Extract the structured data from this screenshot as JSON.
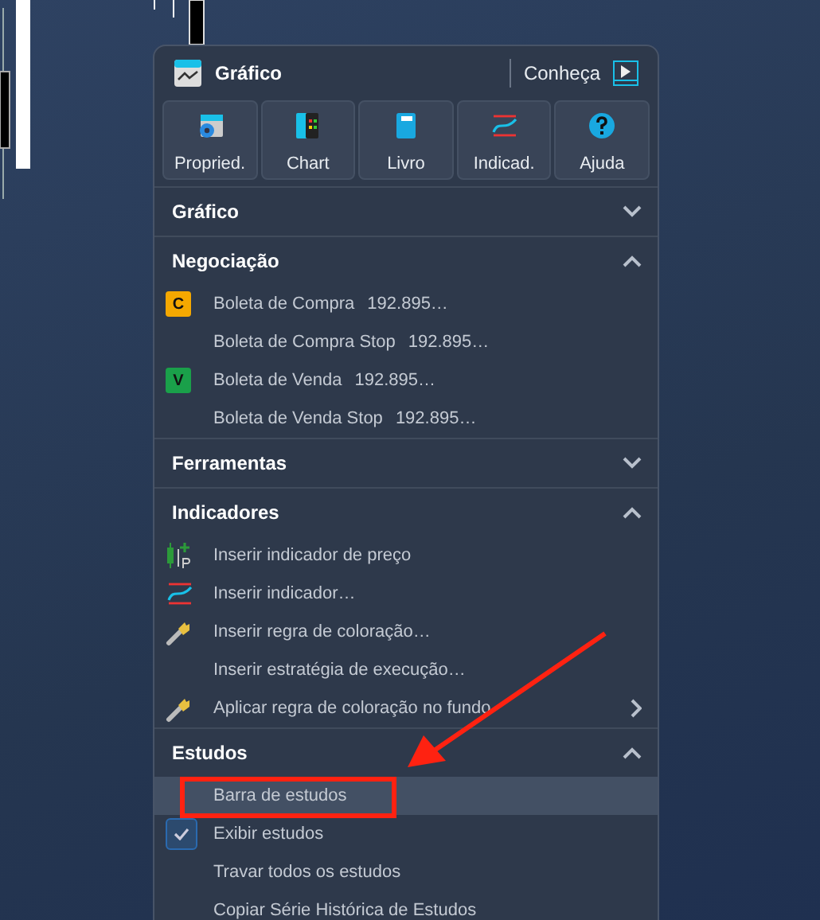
{
  "panel": {
    "title": "Gráfico",
    "tour_link": "Conheça"
  },
  "toolbar": [
    {
      "label": "Propried."
    },
    {
      "label": "Chart"
    },
    {
      "label": "Livro"
    },
    {
      "label": "Indicad."
    },
    {
      "label": "Ajuda"
    }
  ],
  "sections": [
    {
      "title": "Gráfico",
      "expanded": false
    },
    {
      "title": "Negociação",
      "expanded": true,
      "items": [
        {
          "kind": "badge",
          "badge": "C",
          "color": "#f5a800",
          "label": "Boleta de Compra",
          "value": "192.895…"
        },
        {
          "kind": "plain",
          "label": "Boleta de Compra Stop",
          "value": "192.895…"
        },
        {
          "kind": "badge",
          "badge": "V",
          "color": "#1aa04a",
          "label": "Boleta de Venda",
          "value": "192.895…"
        },
        {
          "kind": "plain",
          "label": "Boleta de Venda Stop",
          "value": "192.895…"
        }
      ]
    },
    {
      "title": "Ferramentas",
      "expanded": false
    },
    {
      "title": "Indicadores",
      "expanded": true,
      "items": [
        {
          "kind": "price",
          "label": "Inserir indicador de preço"
        },
        {
          "kind": "indicator",
          "label": "Inserir indicador…"
        },
        {
          "kind": "brush",
          "label": "Inserir regra de coloração…"
        },
        {
          "kind": "plain",
          "label": "Inserir estratégia de execução…"
        },
        {
          "kind": "brush",
          "label": "Aplicar regra de coloração no fundo",
          "submenu": true
        }
      ]
    },
    {
      "title": "Estudos",
      "expanded": true,
      "items": [
        {
          "kind": "plain",
          "label": "Barra de estudos",
          "selected": true,
          "annotated": true
        },
        {
          "kind": "check",
          "label": "Exibir estudos",
          "checked": true,
          "selected": false
        },
        {
          "kind": "plain",
          "label": "Travar todos os estudos",
          "selected": false
        },
        {
          "kind": "plain",
          "label": "Copiar Série Histórica de Estudos",
          "selected": false
        }
      ]
    }
  ]
}
